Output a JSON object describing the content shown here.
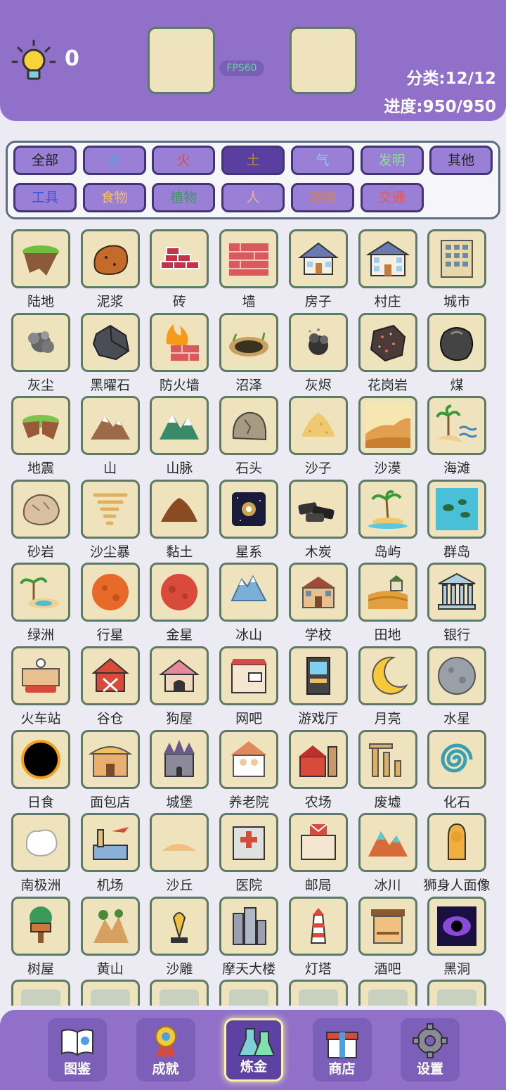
{
  "header": {
    "hint_count": "0",
    "fps": "FPS60",
    "category_stat": "分类:12/12",
    "progress_stat": "进度:950/950"
  },
  "filters": [
    {
      "label": "全部",
      "color": "#222222"
    },
    {
      "label": "水",
      "color": "#4aa0e0"
    },
    {
      "label": "火",
      "color": "#e04a3a"
    },
    {
      "label": "土",
      "color": "#b08a3a",
      "active": true
    },
    {
      "label": "气",
      "color": "#7fd0f0"
    },
    {
      "label": "发明",
      "color": "#8fe08f"
    },
    {
      "label": "其他",
      "color": "#222222"
    },
    {
      "label": "工具",
      "color": "#3a56d8"
    },
    {
      "label": "食物",
      "color": "#f0c060"
    },
    {
      "label": "植物",
      "color": "#3a9a5a"
    },
    {
      "label": "人",
      "color": "#f0b0a0"
    },
    {
      "label": "动物",
      "color": "#e08040"
    },
    {
      "label": "交通",
      "color": "#e05a5a"
    }
  ],
  "elements": [
    {
      "name": "陆地",
      "icon": "land-icon"
    },
    {
      "name": "泥浆",
      "icon": "mud-icon"
    },
    {
      "name": "砖",
      "icon": "brick-icon"
    },
    {
      "name": "墙",
      "icon": "wall-icon"
    },
    {
      "name": "房子",
      "icon": "house-icon"
    },
    {
      "name": "村庄",
      "icon": "village-icon"
    },
    {
      "name": "城市",
      "icon": "city-icon"
    },
    {
      "name": "灰尘",
      "icon": "dust-icon"
    },
    {
      "name": "黑曜石",
      "icon": "obsidian-icon"
    },
    {
      "name": "防火墙",
      "icon": "firewall-icon"
    },
    {
      "name": "沼泽",
      "icon": "swamp-icon"
    },
    {
      "name": "灰烬",
      "icon": "ash-icon"
    },
    {
      "name": "花岗岩",
      "icon": "granite-icon"
    },
    {
      "name": "煤",
      "icon": "coal-icon"
    },
    {
      "name": "地震",
      "icon": "earthquake-icon"
    },
    {
      "name": "山",
      "icon": "mountain-icon"
    },
    {
      "name": "山脉",
      "icon": "mountain-range-icon"
    },
    {
      "name": "石头",
      "icon": "stone-icon"
    },
    {
      "name": "沙子",
      "icon": "sand-icon"
    },
    {
      "name": "沙漠",
      "icon": "desert-icon"
    },
    {
      "name": "海滩",
      "icon": "beach-icon"
    },
    {
      "name": "砂岩",
      "icon": "sandstone-icon"
    },
    {
      "name": "沙尘暴",
      "icon": "sandstorm-icon"
    },
    {
      "name": "黏土",
      "icon": "clay-icon"
    },
    {
      "name": "星系",
      "icon": "galaxy-icon"
    },
    {
      "name": "木炭",
      "icon": "charcoal-icon"
    },
    {
      "name": "岛屿",
      "icon": "island-icon"
    },
    {
      "name": "群岛",
      "icon": "archipelago-icon"
    },
    {
      "name": "绿洲",
      "icon": "oasis-icon"
    },
    {
      "name": "行星",
      "icon": "planet-icon"
    },
    {
      "name": "金星",
      "icon": "venus-icon"
    },
    {
      "name": "冰山",
      "icon": "iceberg-icon"
    },
    {
      "name": "学校",
      "icon": "school-icon"
    },
    {
      "name": "田地",
      "icon": "field-icon"
    },
    {
      "name": "银行",
      "icon": "bank-icon"
    },
    {
      "name": "火车站",
      "icon": "train-station-icon"
    },
    {
      "name": "谷仓",
      "icon": "barn-icon"
    },
    {
      "name": "狗屋",
      "icon": "doghouse-icon"
    },
    {
      "name": "网吧",
      "icon": "internet-cafe-icon"
    },
    {
      "name": "游戏厅",
      "icon": "arcade-icon"
    },
    {
      "name": "月亮",
      "icon": "moon-icon"
    },
    {
      "name": "水星",
      "icon": "mercury-icon"
    },
    {
      "name": "日食",
      "icon": "eclipse-icon"
    },
    {
      "name": "面包店",
      "icon": "bakery-icon"
    },
    {
      "name": "城堡",
      "icon": "castle-icon"
    },
    {
      "name": "养老院",
      "icon": "nursing-home-icon"
    },
    {
      "name": "农场",
      "icon": "farm-icon"
    },
    {
      "name": "废墟",
      "icon": "ruins-icon"
    },
    {
      "name": "化石",
      "icon": "fossil-icon"
    },
    {
      "name": "南极洲",
      "icon": "antarctica-icon"
    },
    {
      "name": "机场",
      "icon": "airport-icon"
    },
    {
      "name": "沙丘",
      "icon": "dune-icon"
    },
    {
      "name": "医院",
      "icon": "hospital-icon"
    },
    {
      "name": "邮局",
      "icon": "post-office-icon"
    },
    {
      "name": "冰川",
      "icon": "glacier-icon"
    },
    {
      "name": "狮身人面像",
      "icon": "sphinx-icon"
    },
    {
      "name": "树屋",
      "icon": "treehouse-icon"
    },
    {
      "name": "黄山",
      "icon": "huangshan-icon"
    },
    {
      "name": "沙雕",
      "icon": "sand-sculpture-icon"
    },
    {
      "name": "摩天大楼",
      "icon": "skyscraper-icon"
    },
    {
      "name": "灯塔",
      "icon": "lighthouse-icon"
    },
    {
      "name": "酒吧",
      "icon": "bar-icon"
    },
    {
      "name": "黑洞",
      "icon": "black-hole-icon"
    },
    {
      "name": "",
      "icon": "partial-icon"
    },
    {
      "name": "",
      "icon": "partial-icon"
    },
    {
      "name": "",
      "icon": "partial-icon"
    },
    {
      "name": "",
      "icon": "partial-icon"
    },
    {
      "name": "",
      "icon": "partial-icon"
    },
    {
      "name": "",
      "icon": "partial-icon"
    },
    {
      "name": "",
      "icon": "partial-icon"
    }
  ],
  "nav": [
    {
      "label": "图鉴",
      "icon": "book-icon"
    },
    {
      "label": "成就",
      "icon": "medal-icon"
    },
    {
      "label": "炼金",
      "icon": "flask-icon",
      "active": true
    },
    {
      "label": "商店",
      "icon": "gift-icon"
    },
    {
      "label": "设置",
      "icon": "gear-icon"
    }
  ]
}
